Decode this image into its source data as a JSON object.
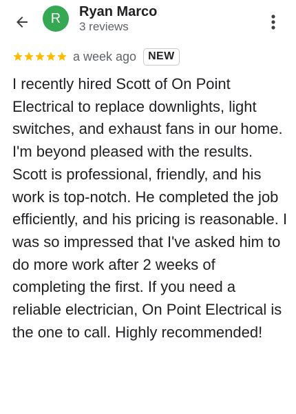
{
  "reviewer": {
    "name": "Ryan Marco",
    "avatar_initial": "R",
    "avatar_color": "#34a853",
    "review_count": "3 reviews"
  },
  "header": {
    "back_icon": "arrow-left-icon",
    "more_icon": "more-vert-icon"
  },
  "review": {
    "rating": 5,
    "max_rating": 5,
    "star_color": "#fbbc04",
    "date": "a week ago",
    "badge": "NEW",
    "text": "I recently hired Scott of On Point Electrical to replace downlights, light switches, and exhaust fans in our home. I'm beyond pleased with the results. Scott is professional, friendly, and his work is top-notch. He completed the job efficiently, and his pricing is reasonable. I was so impressed that I've asked him to do more work after 2 weeks of completing the first. If you need a reliable electrician, On Point Electrical is the one to call. Highly recommended!"
  }
}
